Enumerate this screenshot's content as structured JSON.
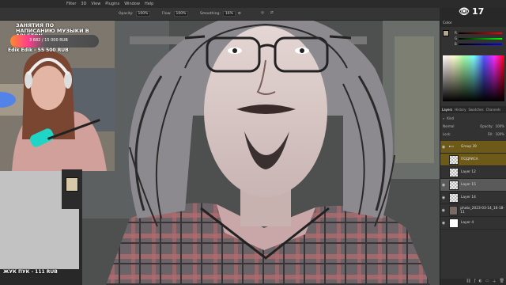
{
  "menu": [
    "Filter",
    "3D",
    "View",
    "Plugins",
    "Window",
    "Help"
  ],
  "options": {
    "opacity_label": "Opacity:",
    "opacity_value": "100%",
    "flow_label": "Flow:",
    "flow_value": "100%",
    "smoothing_label": "Smoothing:",
    "smoothing_value": "16%"
  },
  "stream": {
    "title": "ЗАНЯТИЯ ПО НАПИСАНИЮ МУЗЫКИ В ABLETON",
    "goal_text": "3 682 / 15 000 RUB",
    "donor_line": "Edik Edik - 55 500 RUB",
    "bottom_donor": "ЖУК ПУК - 111 RUB",
    "viewer_count": "17"
  },
  "panel": {
    "color_title": "Color",
    "rgb_letters": [
      "R",
      "G",
      "B"
    ],
    "rgb_values": [
      "",
      "",
      ""
    ],
    "tabs": [
      "Layers",
      "History",
      "Swatches",
      "Channels"
    ],
    "kind_label": "Kind",
    "blend_mode": "Normal",
    "opacity_label": "Opacity:",
    "opacity_value": "100%",
    "lock_label": "Lock:",
    "fill_label": "Fill:",
    "fill_value": "100%",
    "layers": [
      {
        "name": "Group 39"
      },
      {
        "name": "ПОДРИСА"
      },
      {
        "name": "Layer 12"
      },
      {
        "name": "Layer 15"
      },
      {
        "name": "Layer 14"
      },
      {
        "name": "photo_2023-03-14_16-18-11"
      },
      {
        "name": "Layer 4"
      }
    ]
  },
  "colors": {
    "accent": "#31a8ff",
    "group_highlight": "#6e5a18"
  }
}
